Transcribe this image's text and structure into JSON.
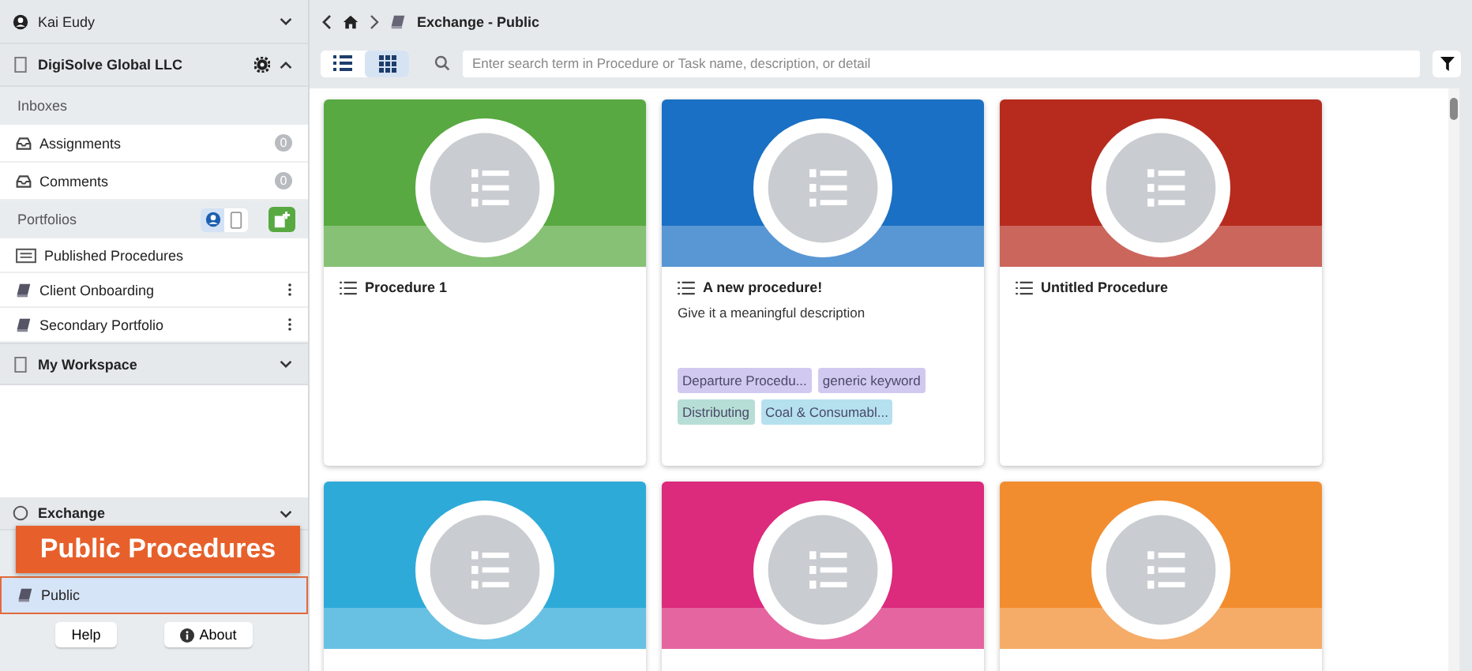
{
  "user": {
    "name": "Kai Eudy"
  },
  "organization": {
    "name": "DigiSolve Global LLC"
  },
  "inboxes": {
    "title": "Inboxes",
    "items": [
      {
        "label": "Assignments",
        "count": "0"
      },
      {
        "label": "Comments",
        "count": "0"
      }
    ]
  },
  "portfolios": {
    "title": "Portfolios",
    "filters": [
      {
        "kind": "person",
        "selected": true
      },
      {
        "kind": "device",
        "selected": false
      }
    ],
    "items": [
      {
        "kind": "published",
        "label": "Published Procedures",
        "menu": false
      },
      {
        "kind": "portfolio",
        "label": "Client Onboarding",
        "menu": true
      },
      {
        "kind": "portfolio",
        "label": "Secondary Portfolio",
        "menu": true
      }
    ]
  },
  "workspace": {
    "title": "My Workspace",
    "expanded": false
  },
  "exchange": {
    "title": "Exchange",
    "items": [
      {
        "label": "Public",
        "selected": true
      }
    ]
  },
  "callout": {
    "text": "Public Procedures"
  },
  "footer": {
    "buttons": [
      {
        "kind": "help",
        "label": "Help"
      },
      {
        "kind": "about",
        "label": "About"
      }
    ]
  },
  "breadcrumb": {
    "current": "Exchange - Public"
  },
  "view_toggle": [
    {
      "kind": "list",
      "selected": false
    },
    {
      "kind": "grid",
      "selected": true
    }
  ],
  "search": {
    "placeholder": "Enter search term in Procedure or Task name, description, or detail"
  },
  "cards": [
    {
      "title": "Procedure 1",
      "color": "#58a941"
    },
    {
      "title": "A new procedure!",
      "color": "#1a70c4",
      "description": "Give it a meaningful description",
      "tags": [
        {
          "label": "Departure Procedu...",
          "color": "#d2c9f0"
        },
        {
          "label": "generic keyword",
          "color": "#d2c9f0"
        },
        {
          "label": "Distributing",
          "color": "#b7ded6"
        },
        {
          "label": "Coal & Consumabl...",
          "color": "#b5e1ef"
        }
      ]
    },
    {
      "title": "Untitled Procedure",
      "color": "#b72b1f"
    },
    {
      "color": "#2eaad8"
    },
    {
      "color": "#dc2a7c"
    },
    {
      "color": "#f28d2f"
    }
  ]
}
